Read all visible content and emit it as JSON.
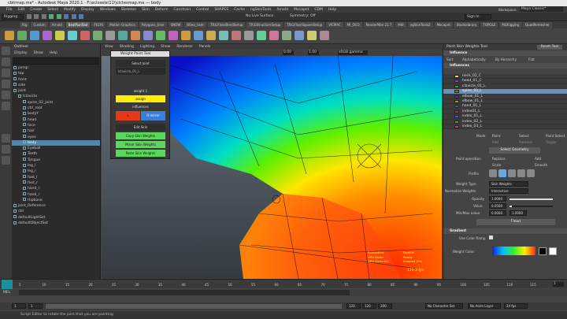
{
  "window": {
    "title": "cbtrmap.ma* - Autodesk Maya 2020.1 - F:\\ecloxele\\11\\\\clctesmap.ma   ---   body"
  },
  "menus": [
    "File",
    "Edit",
    "Create",
    "Select",
    "Modify",
    "Display",
    "Windows",
    "Skeleton",
    "Skin",
    "Deform",
    "Constrain",
    "Control",
    "SHAPES",
    "Cache",
    "ngSkinTools",
    "Arnold",
    "Mocapnt",
    "CDM",
    "Help"
  ],
  "status": {
    "workspace_label": "Workspace:",
    "workspace_value": "Maya Classic*",
    "mode": "Rigging",
    "signin": "Sign In",
    "live": "No Live Surface",
    "symmetry": "Symmetry: Off"
  },
  "shelf_tabs": [
    "Rig",
    "Custom",
    "Arnold",
    "BeatRunTool",
    "FK1Rt",
    "Motion Graphics",
    "Polygons_User",
    "SNOW",
    "BGeo_User",
    "TRiGFloorBendSetup",
    "TRiGStructureSetup",
    "TRiGFloorSquareSetup",
    "VICMAC",
    "MI_OCO",
    "RenderMan 21.7",
    "MdI",
    "ngSkinTools2",
    "Mocapnt",
    "Studiolibrary",
    "TOPOLE",
    "MGRigging",
    "QuadRemesher"
  ],
  "outliner": {
    "title": "Outliner",
    "menu": [
      "Display",
      "Show",
      "Help"
    ],
    "items": [
      "persp",
      "top",
      "front",
      "side",
      "joint",
      "lclavicle",
      "spine_02_joint",
      "ctrl_root",
      "bodyY",
      "head",
      "face",
      "hair",
      "eyes",
      "body",
      "Eyeball",
      "Teeth",
      "Tongue",
      "leg_l",
      "leg_r",
      "foot_l",
      "foot_r",
      "hand_l",
      "hand_r",
      "Hipbone",
      "joint_Reference",
      "ctrl",
      "defaultLightSet",
      "defaultObjectSet"
    ],
    "selected_index": 13
  },
  "viewport": {
    "menus": [
      "View",
      "Shading",
      "Lighting",
      "Show",
      "Renderer",
      "Panels"
    ],
    "value_a": "0.00",
    "value_b": "1.00",
    "colorspace": "sRGB gamma",
    "hud_left": [
      "Evaluation:",
      "GPU Mode:",
      "GPU Override:"
    ],
    "hud_right": [
      "Parallel",
      "Ready",
      "Enabled (Ka)"
    ],
    "fps": "120.3 fps"
  },
  "weight_tool": {
    "title": "Weight Paint Tool",
    "select_joint": "Select Joint",
    "current_joint": "lclavicle_01_L",
    "weight_label": "weight 1",
    "assign": "assign",
    "influences": "influences",
    "mirror_l": "L",
    "mirror_r": "R mirror",
    "edit_skin": "Edit Skin",
    "copy": "Copy Skin Weights",
    "mirror": "Mirror Skin Weights",
    "paste": "Paste Skin Weights"
  },
  "right_panel": {
    "title": "Paint Skin Weights Tool",
    "reset": "Reset Tool",
    "section_influence": "Influence",
    "sort_label": "Sort",
    "sort_opts": [
      "Alphabetically",
      "By Hierarchy",
      "Flat"
    ],
    "section_influences": "Influences",
    "influences": [
      "neck_02_C",
      "head_01_C",
      "clavicle_01_L",
      "spine_03_L",
      "elbow_01_L",
      "elbow_01_L",
      "hand_01_L",
      "index01_L",
      "index_01_L",
      "index_02_L",
      "index_03_L"
    ],
    "influence_colors": [
      "#ffd93b",
      "#8a3ccd",
      "#3e9c3e",
      "#7a7a2a",
      "#5f2d9a",
      "#c28a2a",
      "#2b6a8a",
      "#9a3a4a",
      "#3c5fd0",
      "#4f9c4f",
      "#b05050"
    ],
    "selected_index": 3,
    "mode_label": "Mode",
    "modes": [
      "Paint",
      "Select",
      "Paint Select"
    ],
    "select_opts": [
      "Add",
      "Remove",
      "Toggle"
    ],
    "select_geometry": "Select Geometry",
    "paint_op_label": "Paint operation",
    "paint_ops": [
      "Replace",
      "Add",
      "Scale",
      "Smooth"
    ],
    "profile_label": "Profile",
    "weight_type_label": "Weight Type",
    "weight_type": "Skin Weights",
    "normalize_label": "Normalize Weights",
    "normalize": "Interactive",
    "opacity_label": "Opacity",
    "opacity": "1.0000",
    "value_label": "Value",
    "value": "0.0500",
    "min_max_label": "Min/Max value",
    "min": "0.0000",
    "max": "1.0000",
    "flood": "Flood",
    "section_gradient": "Gradient",
    "use_ramp": "Use Color Ramp",
    "weight_color_label": "Weight Color:"
  },
  "timeline": {
    "ticks": [
      "5",
      "10",
      "15",
      "20",
      "25",
      "30",
      "35",
      "40",
      "45",
      "50",
      "55",
      "60",
      "65",
      "70",
      "75",
      "80",
      "85",
      "90",
      "95",
      "100",
      "105",
      "110",
      "115"
    ],
    "current": "1"
  },
  "range": {
    "start": "1",
    "s2": "1",
    "end": "120",
    "e2": "120",
    "e3": "200",
    "charset": "No Character Set",
    "anim_layer": "No Anim Layer",
    "fps": "24 fps"
  },
  "mel": "MEL",
  "help": "Script Editor  to rotate the joint that you are painting"
}
